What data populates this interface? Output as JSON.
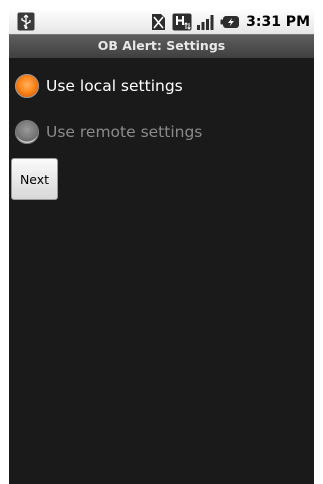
{
  "status_bar": {
    "time": "3:31 PM",
    "icons": [
      "usb-icon",
      "no-sim-icon",
      "h-data-icon",
      "signal-icon",
      "battery-charging-icon"
    ]
  },
  "app_bar": {
    "title": "OB Alert: Settings"
  },
  "settings": {
    "options": [
      {
        "label": "Use local settings",
        "checked": true,
        "enabled": true
      },
      {
        "label": "Use remote settings",
        "checked": false,
        "enabled": false
      }
    ],
    "next_label": "Next"
  },
  "colors": {
    "background": "#1a1a1a",
    "accent": "#ff8a1e",
    "disabled_text": "#8a8a8a"
  }
}
